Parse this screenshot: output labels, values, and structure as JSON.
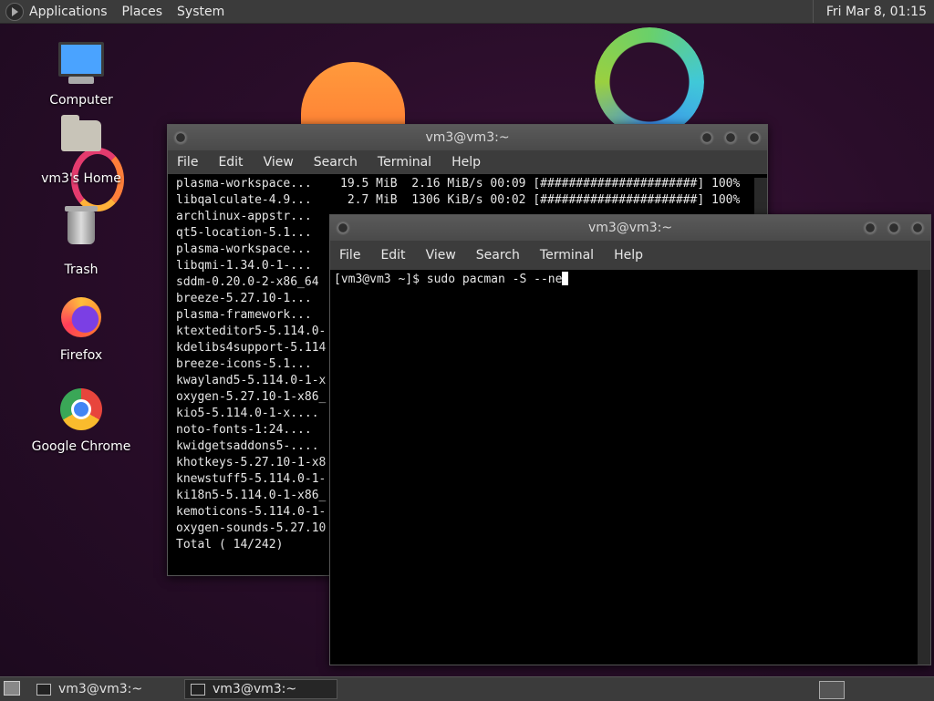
{
  "top_panel": {
    "menus": [
      "Applications",
      "Places",
      "System"
    ],
    "clock": "Fri Mar  8, 01:15"
  },
  "desktop_icons": [
    {
      "label": "Computer",
      "icon": "computer-icon"
    },
    {
      "label": "vm3's Home",
      "icon": "home-folder-icon"
    },
    {
      "label": "Trash",
      "icon": "trash-icon"
    },
    {
      "label": "Firefox",
      "icon": "firefox-icon"
    },
    {
      "label": "Google Chrome",
      "icon": "chrome-icon"
    }
  ],
  "window_back": {
    "title": "vm3@vm3:~",
    "menu": [
      "File",
      "Edit",
      "View",
      "Search",
      "Terminal",
      "Help"
    ],
    "lines": [
      "plasma-workspace...    19.5 MiB  2.16 MiB/s 00:09 [######################] 100%",
      "libqalculate-4.9...     2.7 MiB  1306 KiB/s 00:02 [######################] 100%",
      "archlinux-appstr...",
      "qt5-location-5.1...",
      "plasma-workspace...",
      "libqmi-1.34.0-1-...",
      "sddm-0.20.0-2-x86_64",
      "breeze-5.27.10-1...",
      "plasma-framework...",
      "ktexteditor5-5.114.0-",
      "kdelibs4support-5.114",
      "breeze-icons-5.1...",
      "kwayland5-5.114.0-1-x",
      "oxygen-5.27.10-1-x86_",
      "kio5-5.114.0-1-x....",
      "noto-fonts-1:24....",
      "kwidgetsaddons5-....",
      "khotkeys-5.27.10-1-x8",
      "knewstuff5-5.114.0-1-",
      "ki18n5-5.114.0-1-x86_",
      "kemoticons-5.114.0-1-",
      "oxygen-sounds-5.27.10",
      "Total ( 14/242)"
    ]
  },
  "window_front": {
    "title": "vm3@vm3:~",
    "menu": [
      "File",
      "Edit",
      "View",
      "Search",
      "Terminal",
      "Help"
    ],
    "prompt": "[vm3@vm3 ~]$ sudo pacman -S --ne"
  },
  "taskbar": {
    "tasks": [
      "vm3@vm3:~",
      "vm3@vm3:~"
    ]
  }
}
